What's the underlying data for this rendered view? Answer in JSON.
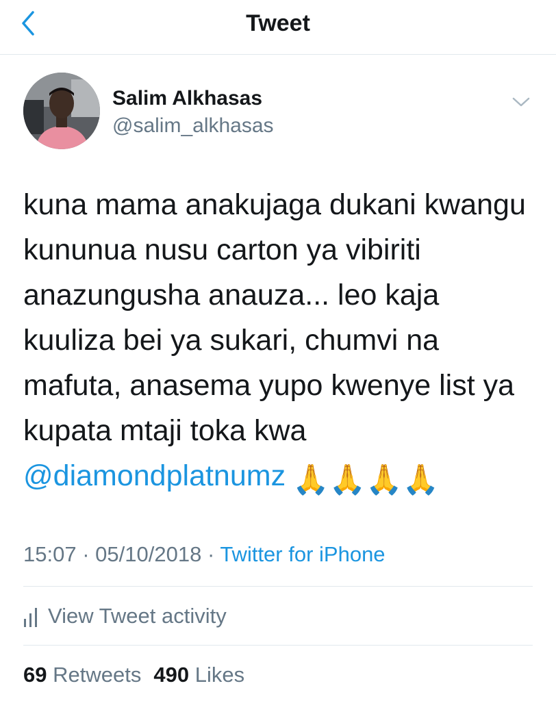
{
  "nav": {
    "title": "Tweet",
    "back_icon": "chevron-left-icon"
  },
  "author": {
    "display_name": "Salim Alkhasas",
    "handle": "@salim_alkhasas",
    "avatar_icon": "profile-photo"
  },
  "tweet": {
    "lines": [
      "kuna mama anakujaga dukani kwangu",
      "kununua nusu carton ya vibiriti",
      "anazungusha anauza... leo kaja",
      "kuuliza bei ya sukari, chumvi na",
      "mafuta, anasema yupo kwenye list ya",
      "kupata mtaji toka kwa"
    ],
    "mention": "@diamondplatnumz",
    "emoji": [
      "🙏",
      "🙏",
      "🙏",
      "🙏"
    ]
  },
  "meta": {
    "time": "15:07",
    "separator": "·",
    "date": "05/10/2018",
    "source": "Twitter for iPhone"
  },
  "activity": {
    "label": "View Tweet activity",
    "icon": "bar-chart-icon"
  },
  "stats": {
    "retweets_count": "69",
    "retweets_label": "Retweets",
    "likes_count": "490",
    "likes_label": "Likes"
  },
  "colors": {
    "link": "#1b95e0",
    "secondary": "#657786",
    "text": "#14171a",
    "divider": "#e1e8ed"
  }
}
